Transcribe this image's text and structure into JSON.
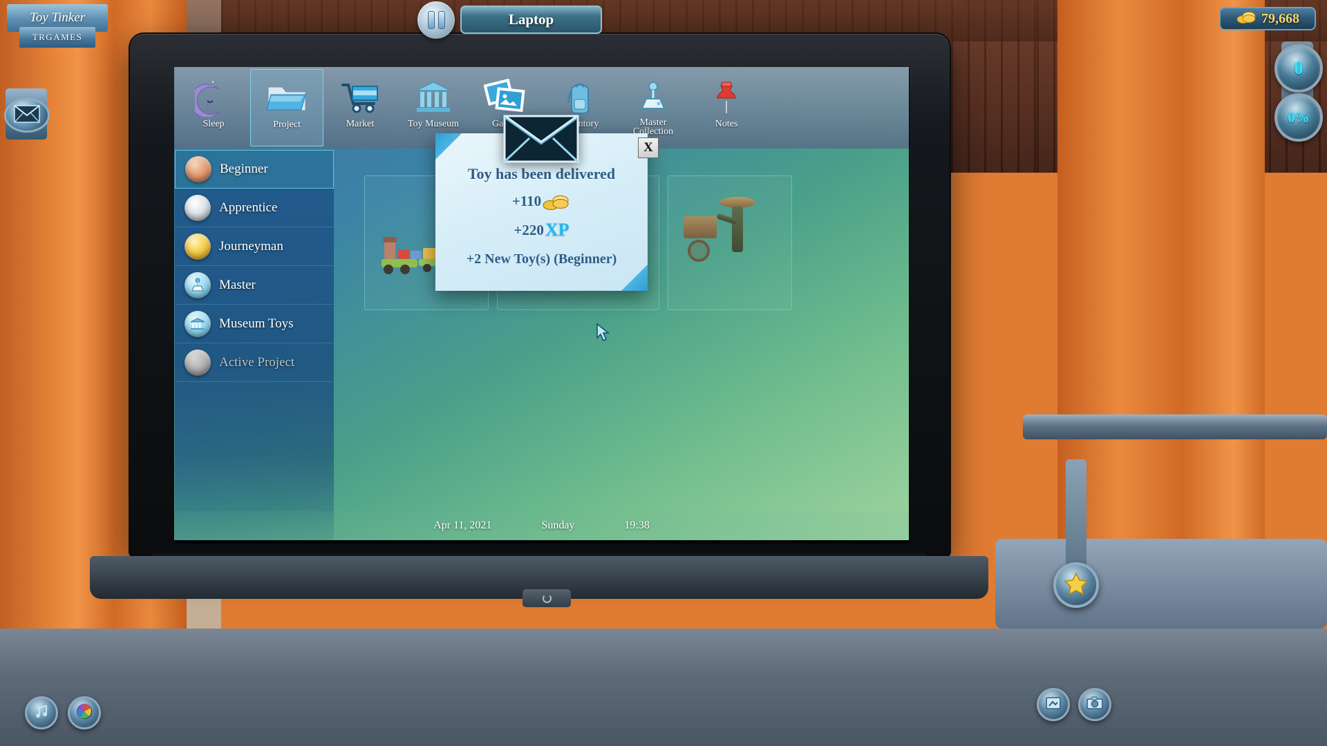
{
  "brand": {
    "title": "Toy Tinker",
    "subtitle": "TRGAMES"
  },
  "topbar": {
    "pause_label": "pause",
    "window_title": "Laptop",
    "coins": "79,668",
    "coin_icon": "coins-icon"
  },
  "hud": {
    "level_value": "0",
    "progress_value": "0%",
    "mail_icon": "envelope-icon",
    "music_icon": "music-note-icon",
    "palette_icon": "color-wheel-icon",
    "star_icon": "star-icon",
    "level_badge_icon": "level-badge-icon",
    "camera_icon": "camera-icon"
  },
  "nav": {
    "items": [
      {
        "label": "Sleep",
        "icon": "moon-icon",
        "selected": false
      },
      {
        "label": "Project",
        "icon": "folder-icon",
        "selected": true
      },
      {
        "label": "Market",
        "icon": "shopping-cart-icon",
        "selected": false
      },
      {
        "label": "Toy Museum",
        "icon": "museum-icon",
        "selected": false
      },
      {
        "label": "Gallery",
        "icon": "photos-icon",
        "selected": false
      },
      {
        "label": "Inventory",
        "icon": "backpack-icon",
        "selected": false
      },
      {
        "label": "Master Collection",
        "icon": "joystick-icon",
        "selected": false
      },
      {
        "label": "Notes",
        "icon": "pushpin-icon",
        "selected": false
      }
    ]
  },
  "sidebar": {
    "items": [
      {
        "label": "Beginner",
        "orb": "orb-bronze",
        "selected": true,
        "disabled": false
      },
      {
        "label": "Apprentice",
        "orb": "orb-silver",
        "selected": false,
        "disabled": false
      },
      {
        "label": "Journeyman",
        "orb": "orb-gold",
        "selected": false,
        "disabled": false
      },
      {
        "label": "Master",
        "orb": "orb-cyan",
        "selected": false,
        "disabled": false
      },
      {
        "label": "Museum Toys",
        "orb": "orb-cyan",
        "selected": false,
        "disabled": false
      },
      {
        "label": "Active Project",
        "orb": "orb-grey",
        "selected": false,
        "disabled": true
      }
    ]
  },
  "content": {
    "cards": [
      {
        "name": "toy-train-card"
      },
      {
        "name": "toy-plane-card"
      },
      {
        "name": "toy-cart-figure-card"
      }
    ]
  },
  "dialog": {
    "icon": "envelope-icon",
    "close_label": "X",
    "title": "Toy has been delivered",
    "coin_reward": "+110",
    "coin_icon": "coins-icon",
    "xp_reward": "+220",
    "xp_label": "XP",
    "new_toys": "+2 New Toy(s) (Beginner)"
  },
  "statusbar": {
    "date": "Apr 11, 2021",
    "weekday": "Sunday",
    "time": "19:38"
  },
  "cursor": {
    "icon": "mouse-cursor-icon"
  }
}
